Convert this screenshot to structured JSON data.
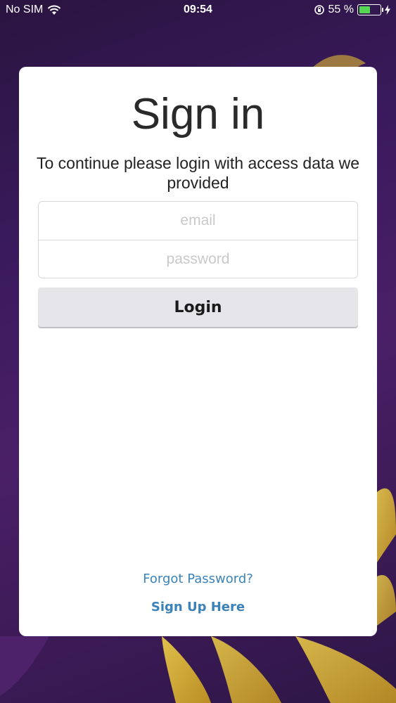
{
  "status_bar": {
    "carrier": "No SIM",
    "time": "09:54",
    "battery_percent": "55 %",
    "battery_level": 0.55
  },
  "login": {
    "title": "Sign in",
    "subtitle": "To continue please login with access data we provided",
    "email_placeholder": "email",
    "password_placeholder": "password",
    "login_label": "Login",
    "forgot_label": "Forgot Password?",
    "signup_label": "Sign Up Here"
  },
  "colors": {
    "link": "#3a82b8",
    "background": "#3a1a5c",
    "accent_yellow": "#e8c23a"
  }
}
